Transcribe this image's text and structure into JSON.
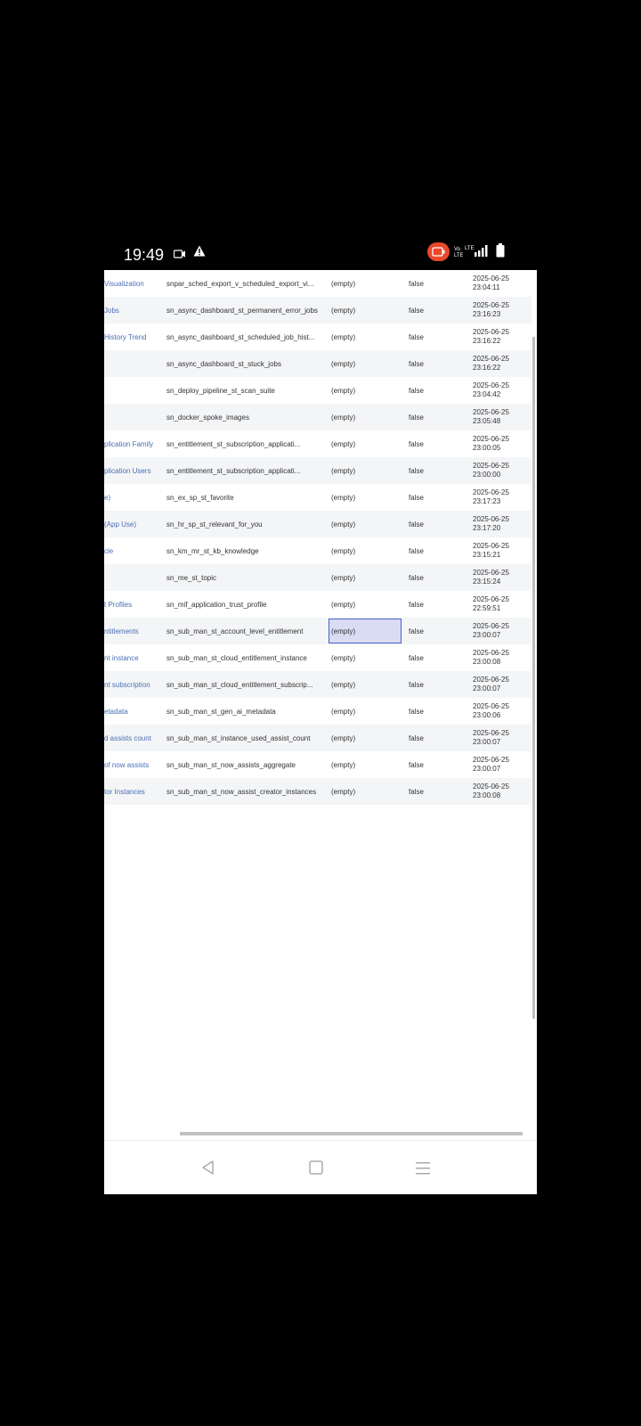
{
  "status_bar": {
    "time": "19:49",
    "icons": [
      "screen-record-icon",
      "warning-icon",
      "recording-pill-icon",
      "volte-icon",
      "lte-signal-icon",
      "battery-icon"
    ],
    "record_color": "#e8492b"
  },
  "table": {
    "rows": [
      {
        "label": "Visualization",
        "name": "snpar_sched_export_v_scheduled_export_vi...",
        "value": "(empty)",
        "active": "false",
        "date": "2025-06-25",
        "time": "23:04:11"
      },
      {
        "label": "Jobs",
        "name": "sn_async_dashboard_st_permanent_error_jobs",
        "value": "(empty)",
        "active": "false",
        "date": "2025-06-25",
        "time": "23:16:23"
      },
      {
        "label": "History Trend",
        "name": "sn_async_dashboard_st_scheduled_job_hist...",
        "value": "(empty)",
        "active": "false",
        "date": "2025-06-25",
        "time": "23:16:22"
      },
      {
        "label": "",
        "name": "sn_async_dashboard_st_stuck_jobs",
        "value": "(empty)",
        "active": "false",
        "date": "2025-06-25",
        "time": "23:16:22"
      },
      {
        "label": "",
        "name": "sn_deploy_pipeline_st_scan_suite",
        "value": "(empty)",
        "active": "false",
        "date": "2025-06-25",
        "time": "23:04:42"
      },
      {
        "label": "",
        "name": "sn_docker_spoke_images",
        "value": "(empty)",
        "active": "false",
        "date": "2025-06-25",
        "time": "23:05:48"
      },
      {
        "label": "plication Family",
        "name": "sn_entitlement_st_subscription_applicati...",
        "value": "(empty)",
        "active": "false",
        "date": "2025-06-25",
        "time": "23:00:05"
      },
      {
        "label": "plication Users",
        "name": "sn_entitlement_st_subscription_applicati...",
        "value": "(empty)",
        "active": "false",
        "date": "2025-06-25",
        "time": "23:00:00"
      },
      {
        "label": "e)",
        "name": "sn_ex_sp_st_favorite",
        "value": "(empty)",
        "active": "false",
        "date": "2025-06-25",
        "time": "23:17:23"
      },
      {
        "label": "(App Use)",
        "name": "sn_hr_sp_st_relevant_for_you",
        "value": "(empty)",
        "active": "false",
        "date": "2025-06-25",
        "time": "23:17:20"
      },
      {
        "label": "cle",
        "name": "sn_km_mr_st_kb_knowledge",
        "value": "(empty)",
        "active": "false",
        "date": "2025-06-25",
        "time": "23:15:21"
      },
      {
        "label": "",
        "name": "sn_me_st_topic",
        "value": "(empty)",
        "active": "false",
        "date": "2025-06-25",
        "time": "23:15:24"
      },
      {
        "label": "t Profiles",
        "name": "sn_mif_application_trust_profile",
        "value": "(empty)",
        "active": "false",
        "date": "2025-06-25",
        "time": "22:59:51"
      },
      {
        "label": "ntitlements",
        "name": "sn_sub_man_st_account_level_entitlement",
        "value": "(empty)",
        "active": "false",
        "date": "2025-06-25",
        "time": "23:00:07"
      },
      {
        "label": "nt instance",
        "name": "sn_sub_man_st_cloud_entitlement_instance",
        "value": "(empty)",
        "active": "false",
        "date": "2025-06-25",
        "time": "23:00:08"
      },
      {
        "label": "nt subscription",
        "name": "sn_sub_man_st_cloud_entitlement_subscrip...",
        "value": "(empty)",
        "active": "false",
        "date": "2025-06-25",
        "time": "23:00:07"
      },
      {
        "label": "etadata",
        "name": "sn_sub_man_st_gen_ai_metadata",
        "value": "(empty)",
        "active": "false",
        "date": "2025-06-25",
        "time": "23:00:06"
      },
      {
        "label": "d assists count",
        "name": "sn_sub_man_st_instance_used_assist_count",
        "value": "(empty)",
        "active": "false",
        "date": "2025-06-25",
        "time": "23:00:07"
      },
      {
        "label": "of now assists",
        "name": "sn_sub_man_st_now_assists_aggregate",
        "value": "(empty)",
        "active": "false",
        "date": "2025-06-25",
        "time": "23:00:07"
      },
      {
        "label": "tor Instances",
        "name": "sn_sub_man_st_now_assist_creator_instances",
        "value": "(empty)",
        "active": "false",
        "date": "2025-06-25",
        "time": "23:00:08"
      }
    ],
    "selected_row": 13
  },
  "nav_bar": {
    "buttons": [
      "back-icon",
      "home-icon",
      "recents-icon"
    ]
  }
}
